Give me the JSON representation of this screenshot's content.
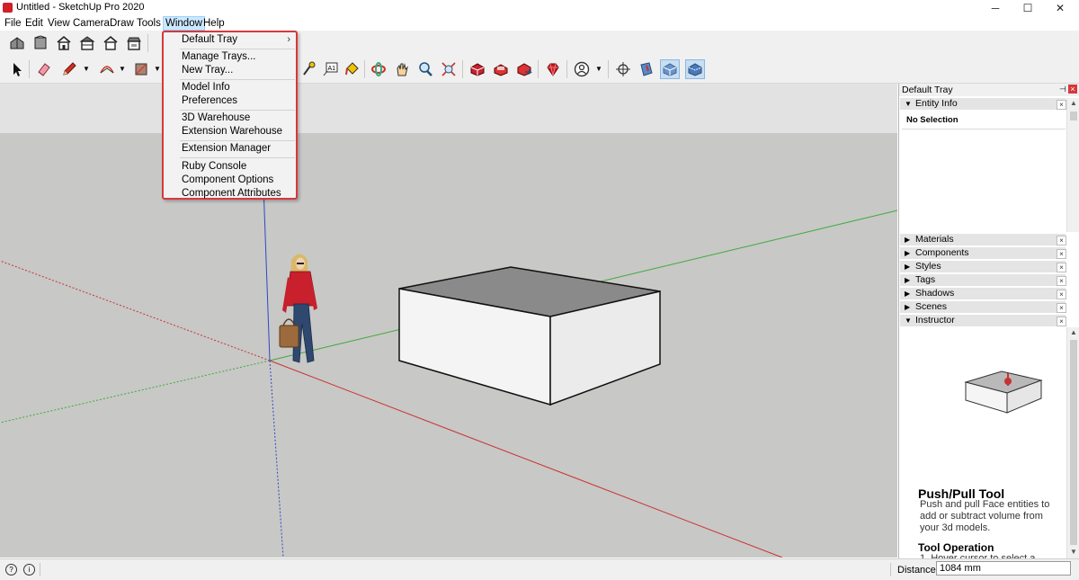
{
  "window": {
    "title": "Untitled - SketchUp Pro 2020",
    "minimize": "─",
    "maximize": "☐",
    "close": "✕"
  },
  "menubar": {
    "items": [
      "File",
      "Edit",
      "View",
      "Camera",
      "Draw",
      "Tools",
      "Window",
      "Help"
    ],
    "active": "Window"
  },
  "window_menu": {
    "items": [
      {
        "label": "Default Tray",
        "submenu": true
      },
      {
        "label": "Manage Trays..."
      },
      {
        "label": "New Tray..."
      },
      {
        "label": "Model Info"
      },
      {
        "label": "Preferences"
      },
      {
        "label": "3D Warehouse"
      },
      {
        "label": "Extension Warehouse"
      },
      {
        "label": "Extension Manager"
      },
      {
        "label": "Ruby Console"
      },
      {
        "label": "Component Options"
      },
      {
        "label": "Component Attributes"
      }
    ],
    "submenu_arrow": "›"
  },
  "colors": {
    "menu_border": "#d6393c",
    "viewport_ground": "#c8c8c6",
    "viewport_sky": "#e2e2e2",
    "axis_red": "#c83232",
    "axis_green": "#3caa3c",
    "axis_blue": "#3246c8",
    "selected_tool": "#c7def3"
  },
  "toolbar": {
    "row1_icons": [
      "iso-view-icon",
      "top-view-icon",
      "front-view-icon",
      "right-view-icon",
      "back-view-icon",
      "left-view-icon"
    ],
    "row2_left_icons": [
      "select-icon",
      "eraser-icon",
      "pencil-icon",
      "arc-icon",
      "rectangle-icon"
    ],
    "row2_right_icons": [
      "tape-measure-icon",
      "text-icon",
      "paint-bucket-icon",
      "orbit-icon",
      "pan-icon",
      "zoom-icon",
      "zoom-extents-icon",
      "3d-warehouse-icon",
      "extension-warehouse-icon",
      "send-to-layout-icon",
      "ruby-icon",
      "account-icon",
      "position-camera-icon",
      "section-plane-icon",
      "xray-icon",
      "back-edges-icon"
    ],
    "text_tool_label": "A1"
  },
  "tray": {
    "title": "Default Tray",
    "pin": "⊣",
    "close": "×",
    "entity_info": {
      "label": "Entity Info",
      "expanded": true,
      "value": "No Selection"
    },
    "panels": [
      {
        "label": "Materials",
        "expanded": false
      },
      {
        "label": "Components",
        "expanded": false
      },
      {
        "label": "Styles",
        "expanded": false
      },
      {
        "label": "Tags",
        "expanded": false
      },
      {
        "label": "Shadows",
        "expanded": false
      },
      {
        "label": "Scenes",
        "expanded": false
      },
      {
        "label": "Instructor",
        "expanded": true
      }
    ],
    "expanded_arrow": "▼",
    "collapsed_arrow": "▶",
    "panel_close": "×",
    "instructor": {
      "title": "Push/Pull Tool",
      "description": "Push and pull Face entities to add or subtract volume from your 3d models.",
      "operation_title": "Tool Operation",
      "step1": "1. Hover cursor to select a"
    }
  },
  "statusbar": {
    "icon1": "?",
    "icon2": "i",
    "distance_label": "Distance",
    "distance_value": "1084 mm"
  }
}
